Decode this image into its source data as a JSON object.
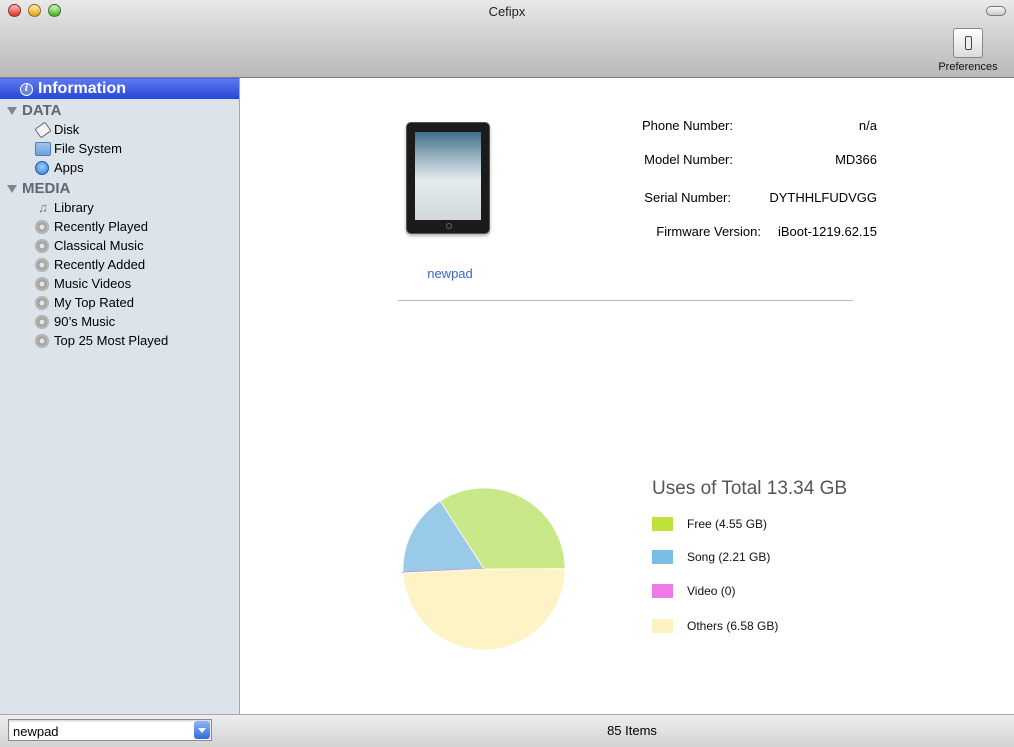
{
  "window": {
    "title": "Cefipx"
  },
  "toolbar": {
    "preferences_label": "Preferences",
    "preferences_icon": "switch-icon"
  },
  "sidebar": {
    "selected": {
      "label": "Information",
      "icon": "info-icon"
    },
    "groups": [
      {
        "label": "DATA",
        "items": [
          {
            "label": "Disk",
            "icon": "disk-icon"
          },
          {
            "label": "File System",
            "icon": "folder-icon"
          },
          {
            "label": "Apps",
            "icon": "app-store-icon"
          }
        ]
      },
      {
        "label": "MEDIA",
        "items": [
          {
            "label": "Library",
            "icon": "music-note-icon"
          },
          {
            "label": "Recently Played",
            "icon": "smart-playlist-icon"
          },
          {
            "label": "Classical Music",
            "icon": "smart-playlist-icon"
          },
          {
            "label": "Recently Added",
            "icon": "smart-playlist-icon"
          },
          {
            "label": "Music Videos",
            "icon": "smart-playlist-icon"
          },
          {
            "label": "My Top Rated",
            "icon": "smart-playlist-icon"
          },
          {
            "label": "90’s Music",
            "icon": "smart-playlist-icon"
          },
          {
            "label": "Top 25 Most Played",
            "icon": "smart-playlist-icon"
          }
        ]
      }
    ]
  },
  "device": {
    "name": "newpad",
    "specs": [
      {
        "label": "Phone Number:",
        "value": "n/a"
      },
      {
        "label": "Model Number:",
        "value": "MD366"
      },
      {
        "label": "Serial Number:",
        "value": "DYTHHLFUDVGG"
      },
      {
        "label": "Firmware Version:",
        "value": "iBoot-1219.62.15"
      }
    ]
  },
  "storage": {
    "title": "Uses of Total 13.34 GB",
    "legend": [
      {
        "label": "Free (4.55 GB)",
        "color": "#bde03a"
      },
      {
        "label": "Song (2.21 GB)",
        "color": "#79bde3"
      },
      {
        "label": "Video (0)",
        "color": "#ee7ae8"
      },
      {
        "label": "Others (6.58 GB)",
        "color": "#fdf3c2"
      }
    ]
  },
  "chart_data": {
    "type": "pie",
    "title": "Uses of Total 13.34 GB",
    "slices": [
      {
        "name": "Free",
        "value": 4.55,
        "color": "#c9e887"
      },
      {
        "name": "Song",
        "value": 2.21,
        "color": "#99cbe8"
      },
      {
        "name": "Video",
        "value": 0,
        "color": "#d77ed0"
      },
      {
        "name": "Others",
        "value": 6.58,
        "color": "#fdf3c5"
      }
    ],
    "legend": "right"
  },
  "bottom": {
    "device_select_value": "newpad",
    "status": "85 Items"
  }
}
